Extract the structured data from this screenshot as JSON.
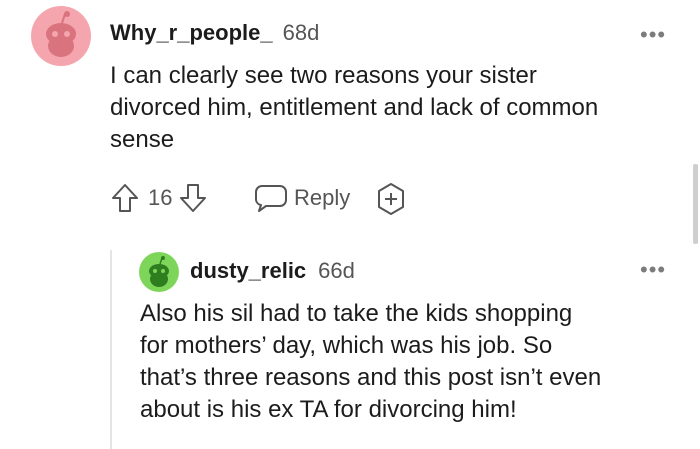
{
  "comment": {
    "username": "Why_r_people_",
    "age": "68d",
    "text_lines": [
      "I can clearly see two reasons your sister",
      "divorced him, entitlement and lack of common",
      "sense"
    ],
    "vote_count": "16",
    "reply_label": "Reply",
    "more_label": "•••",
    "avatar_color": "#f5a5ad"
  },
  "reply": {
    "username": "dusty_relic",
    "age": "66d",
    "text_lines": [
      "Also his sil had to take the kids shopping",
      "for mothers’ day, which was his job. So",
      "that’s three reasons and this post isn’t even",
      "about is his ex TA for divorcing him!"
    ],
    "more_label": "•••",
    "avatar_color": "#7dd65a"
  }
}
